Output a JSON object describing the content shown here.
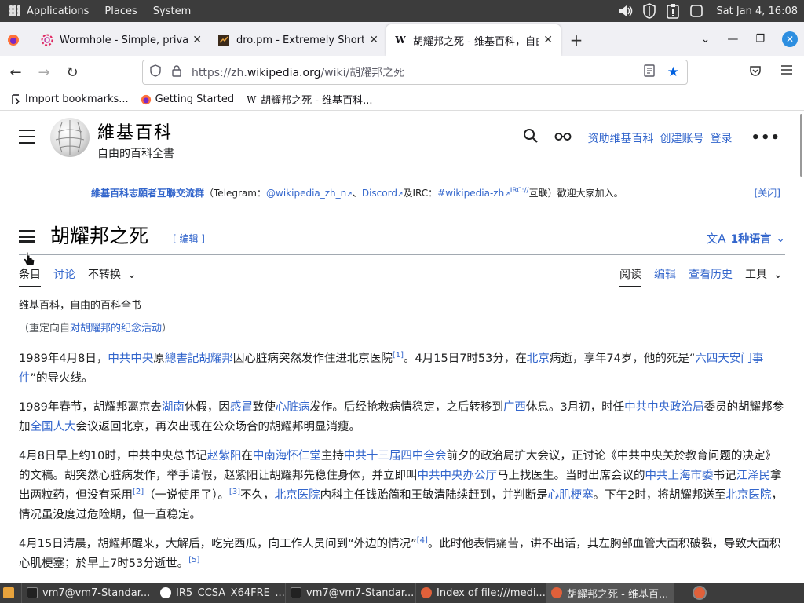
{
  "panel": {
    "applications": "Applications",
    "places": "Places",
    "system": "System",
    "clock": "Sat Jan  4, 16:08"
  },
  "tabs": [
    {
      "title": "Wormhole - Simple, private"
    },
    {
      "title": "dro.pm - Extremely Short Li"
    },
    {
      "title": "胡耀邦之死 - 维基百科，自由"
    }
  ],
  "urlbar": {
    "prefix": "https://zh.",
    "domain": "wikipedia.org",
    "path": "/wiki/胡耀邦之死"
  },
  "bookmarks": [
    {
      "label": "Import bookmarks..."
    },
    {
      "label": "Getting Started"
    },
    {
      "label": "胡耀邦之死 - 维基百科..."
    }
  ],
  "wiki": {
    "site_name": "維基百科",
    "site_tagline": "自由的百科全書",
    "donate": "资助维基百科",
    "create_account": "创建账号",
    "login": "登录",
    "notice": {
      "title": "維基百科志願者互聯交流群",
      "text1": "（Telegram：",
      "tg": "@wikipedia_zh_n",
      "sep1": "、",
      "discord": "Discord",
      "text2": "及IRC：",
      "irc": "#wikipedia-zh",
      "ircsup": "IRC://",
      "text3": "互联）歡迎大家加入。",
      "close": "[关闭]"
    },
    "heading": "胡耀邦之死",
    "edit_section": "[ 编辑 ]",
    "languages": "1种语言",
    "page_tabs": {
      "article": "条目",
      "talk": "讨论",
      "variant": "不转换",
      "read": "阅读",
      "edit": "编辑",
      "history": "查看历史",
      "tools": "工具"
    },
    "site_sub": "维基百科，自由的百科全书",
    "redirect_prefix": "（重定向自",
    "redirect_link": "对胡耀邦的纪念活动",
    "redirect_suffix": "）"
  },
  "article": {
    "p1": {
      "t1": "1989年4月8日，",
      "l1": "中共中央",
      "t2": "原",
      "l2": "總書記",
      "l3": "胡耀邦",
      "t3": "因心脏病突然发作住进北京医院",
      "r1": "[1]",
      "t4": "。4月15日7时53分，在",
      "l4": "北京",
      "t5": "病逝，享年74岁，他的死是“",
      "l5": "六四天安门事件",
      "t6": "”的导火线。"
    },
    "p2": {
      "t1": "1989年春节，胡耀邦离京去",
      "l1": "湖南",
      "t2": "休假，因",
      "l2": "感冒",
      "t3": "致使",
      "l3": "心脏病",
      "t4": "发作。后经抢救病情稳定，之后转移到",
      "l4": "广西",
      "t5": "休息。3月初，时任",
      "l5": "中共中央政治局",
      "t6": "委员的胡耀邦参加",
      "l6": "全国人大",
      "t7": "会议返回北京，再次出现在公众场合的胡耀邦明显消瘦。"
    },
    "p3": {
      "t1": "4月8日早上约10时，中共中央总书记",
      "l1": "赵紫阳",
      "t2": "在",
      "l2": "中南海怀仁堂",
      "t3": "主持",
      "l3": "中共十三届四中全会",
      "t4": "前夕的政治局扩大会议，正讨论《中共中央关於教育问题的决定》的文稿。胡突然心脏病发作，举手请假，赵紫阳让胡耀邦先稳住身体，并立即叫",
      "l4": "中共中央办公厅",
      "t5": "马上找医生。当时出席会议的",
      "l5": "中共上海市委",
      "t6": "书记",
      "l6": "江泽民",
      "t7": "拿出两粒药，但没有采用",
      "r2": "[2]",
      "t8": "（一说使用了）。",
      "r3": "[3]",
      "t9": "不久，",
      "l7": "北京医院",
      "t10": "内科主任钱贻简和王敏清陆续赶到，并判断是",
      "l8": "心肌梗塞",
      "t11": "。下午2时，将胡耀邦送至",
      "l9": "北京医院",
      "t12": "，情况虽没度过危险期，但一直稳定。"
    },
    "p4": {
      "t1": "4月15日清晨，胡耀邦醒来，大解后，吃完西瓜，向工作人员问到“外边的情况”",
      "r4": "[4]",
      "t2": "。此时他表情痛苦，讲不出话，其左胸部血管大面积破裂，导致大面积心肌梗塞；於早上7时53分逝世。",
      "r5": "[5]"
    }
  },
  "taskbar": [
    {
      "label": "vm7@vm7-Standar..."
    },
    {
      "label": "IR5_CCSA_X64FRE_..."
    },
    {
      "label": "vm7@vm7-Standar..."
    },
    {
      "label": "Index of file:///medi..."
    },
    {
      "label": "胡耀邦之死 - 维基百..."
    }
  ],
  "colors": {
    "link": "#3366cc",
    "panel": "#3c3c3c",
    "firefox_close": "#2d8ee0"
  }
}
